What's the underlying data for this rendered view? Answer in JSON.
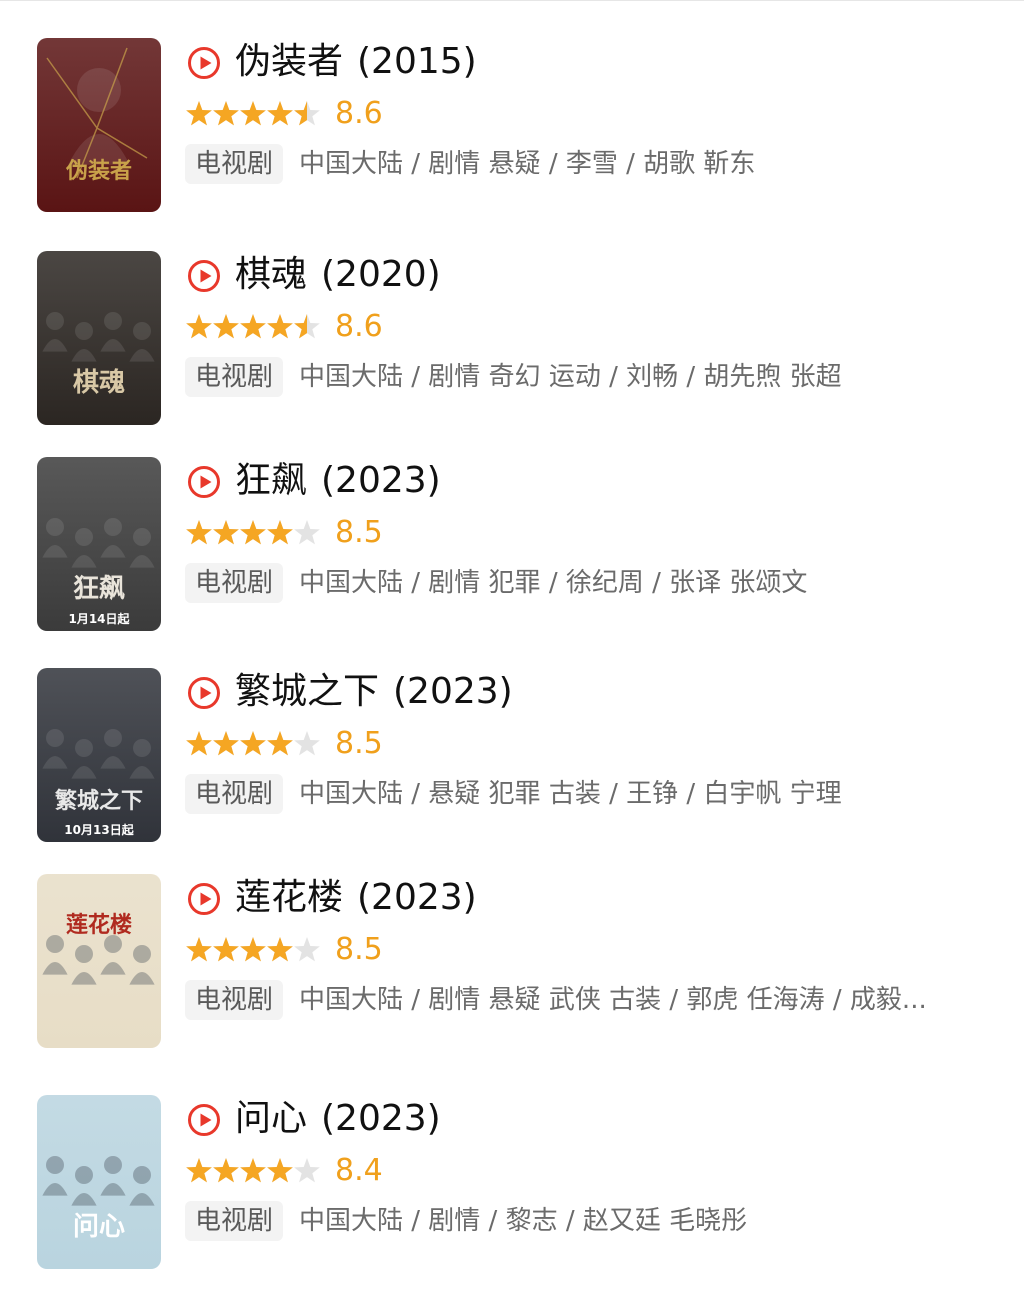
{
  "items": [
    {
      "title": "伪装者",
      "year": "(2015)",
      "rating": "8.6",
      "stars": 4.5,
      "tag": "电视剧",
      "meta": "中国大陆 / 剧情 悬疑 / 李雪 / 胡歌 靳东",
      "poster_bg": "#5a1414",
      "poster_accent": "#c9a24a",
      "poster_text": "伪装者"
    },
    {
      "title": "棋魂",
      "year": "(2020)",
      "rating": "8.6",
      "stars": 4.5,
      "tag": "电视剧",
      "meta": "中国大陆 / 剧情 奇幻 运动 / 刘畅 / 胡先煦 张超",
      "poster_bg": "#2b2622",
      "poster_accent": "#d8c8a6",
      "poster_text": "棋魂"
    },
    {
      "title": "狂飙",
      "year": "(2023)",
      "rating": "8.5",
      "stars": 4,
      "tag": "电视剧",
      "meta": "中国大陆 / 剧情 犯罪 / 徐纪周 / 张译 张颂文",
      "poster_bg": "#3b3b3b",
      "poster_accent": "#e9e4da",
      "poster_text": "狂飙",
      "poster_caption": "1月14日起"
    },
    {
      "title": "繁城之下",
      "year": "(2023)",
      "rating": "8.5",
      "stars": 4,
      "tag": "电视剧",
      "meta": "中国大陆 / 悬疑 犯罪 古装 / 王铮 / 白宇帆 宁理",
      "poster_bg": "#30333a",
      "poster_accent": "#e8e8e8",
      "poster_text": "繁城之下",
      "poster_caption": "10月13日起"
    },
    {
      "title": "莲花楼",
      "year": "(2023)",
      "rating": "8.5",
      "stars": 4,
      "tag": "电视剧",
      "meta": "中国大陆 / 剧情 悬疑 武侠 古装 / 郭虎 任海涛 / 成毅...",
      "poster_bg": "#e7ddc6",
      "poster_accent": "#b02a1f",
      "poster_text": "莲花楼"
    },
    {
      "title": "问心",
      "year": "(2023)",
      "rating": "8.4",
      "stars": 4,
      "tag": "电视剧",
      "meta": "中国大陆 / 剧情 / 黎志 / 赵又廷 毛晓彤",
      "poster_bg": "#b9d4df",
      "poster_accent": "#ffffff",
      "poster_text": "问心"
    }
  ],
  "colors": {
    "star_filled": "#f5a623",
    "star_empty": "#e3e3e3",
    "play_red": "#e8382b",
    "score": "#f0a01c"
  },
  "icons": {
    "play": "play-circle-icon",
    "star": "star-icon"
  }
}
